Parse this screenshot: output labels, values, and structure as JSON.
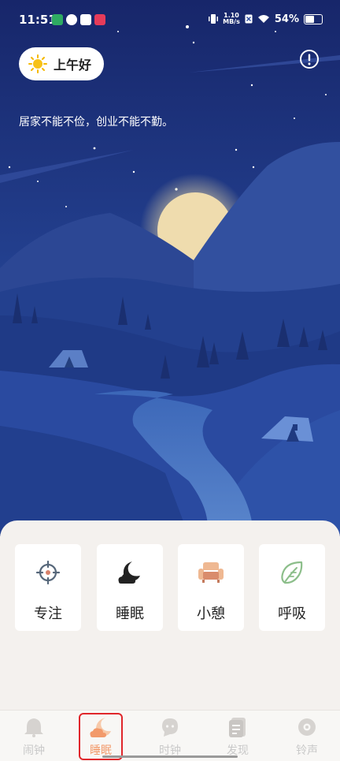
{
  "status_bar": {
    "time": "11:51",
    "net_speed_value": "1.10",
    "net_speed_unit": "MB/s",
    "battery": "54%"
  },
  "header": {
    "greeting": "上午好",
    "quote": "居家不能不俭，创业不能不勤。"
  },
  "cards": [
    {
      "label": "专注",
      "icon": "target-icon"
    },
    {
      "label": "睡眠",
      "icon": "moon-cloud-icon"
    },
    {
      "label": "小憩",
      "icon": "armchair-icon"
    },
    {
      "label": "呼吸",
      "icon": "leaf-icon"
    }
  ],
  "tabs": [
    {
      "label": "闹钟",
      "icon": "alarm-bell-icon"
    },
    {
      "label": "睡眠",
      "icon": "sleep-icon",
      "active": true
    },
    {
      "label": "时钟",
      "icon": "clock-icon"
    },
    {
      "label": "发现",
      "icon": "discover-icon"
    },
    {
      "label": "铃声",
      "icon": "ringtone-icon"
    }
  ],
  "colors": {
    "sky_top": "#17266a",
    "sky_bottom": "#2b52a8",
    "accent": "#f29a6b",
    "highlight": "#e0262b"
  }
}
